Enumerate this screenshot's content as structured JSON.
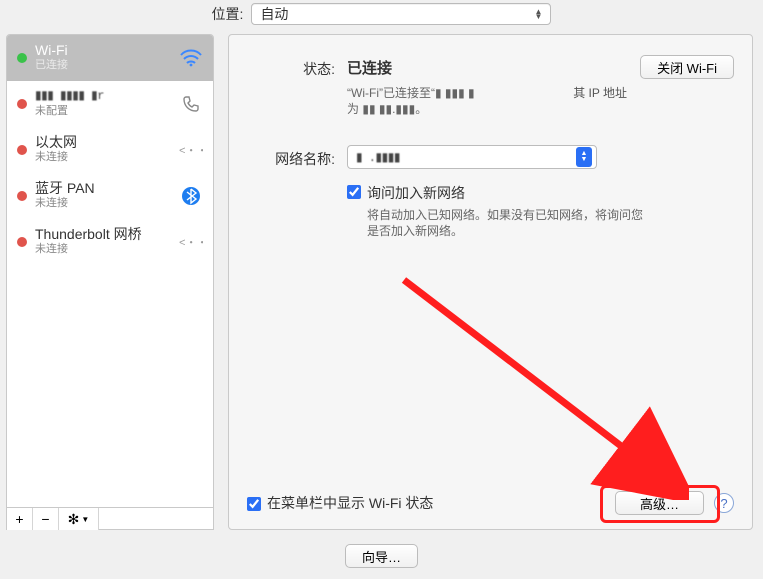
{
  "location": {
    "label": "位置:",
    "value": "自动"
  },
  "sidebar": {
    "items": [
      {
        "dot": "green",
        "title": "Wi-Fi",
        "sub": "已连接",
        "icon": "wifi",
        "selected": true
      },
      {
        "dot": "red",
        "title": "▮▮▮ ▮▮▮▮ ▮r",
        "sub": "未配置",
        "icon": "phone"
      },
      {
        "dot": "red",
        "title": "以太网",
        "sub": "未连接",
        "icon": "ethernet"
      },
      {
        "dot": "red",
        "title": "蓝牙 PAN",
        "sub": "未连接",
        "icon": "bluetooth"
      },
      {
        "dot": "red",
        "title": "Thunderbolt 网桥",
        "sub": "未连接",
        "icon": "ethernet"
      }
    ],
    "toolbar": {
      "add": "+",
      "remove": "−",
      "gear": "✻"
    }
  },
  "detail": {
    "status_label": "状态:",
    "status_value": "已连接",
    "turn_off_btn": "关闭 Wi-Fi",
    "status_desc_1": "“Wi-Fi”已连接至“▮ ▮▮▮ ▮",
    "status_desc_2": "为 ▮▮ ▮▮.▮▮▮。",
    "ip_label": "其 IP 地址",
    "network_label": "网络名称:",
    "network_value": "▮ .▮▮▮▮",
    "ask_join_label": "询问加入新网络",
    "ask_join_desc": "将自动加入已知网络。如果没有已知网络，将询问您是否加入新网络。",
    "menubar_label": "在菜单栏中显示 Wi-Fi 状态",
    "advanced_btn": "高级…",
    "help": "?"
  },
  "wizard_btn": "向导…"
}
